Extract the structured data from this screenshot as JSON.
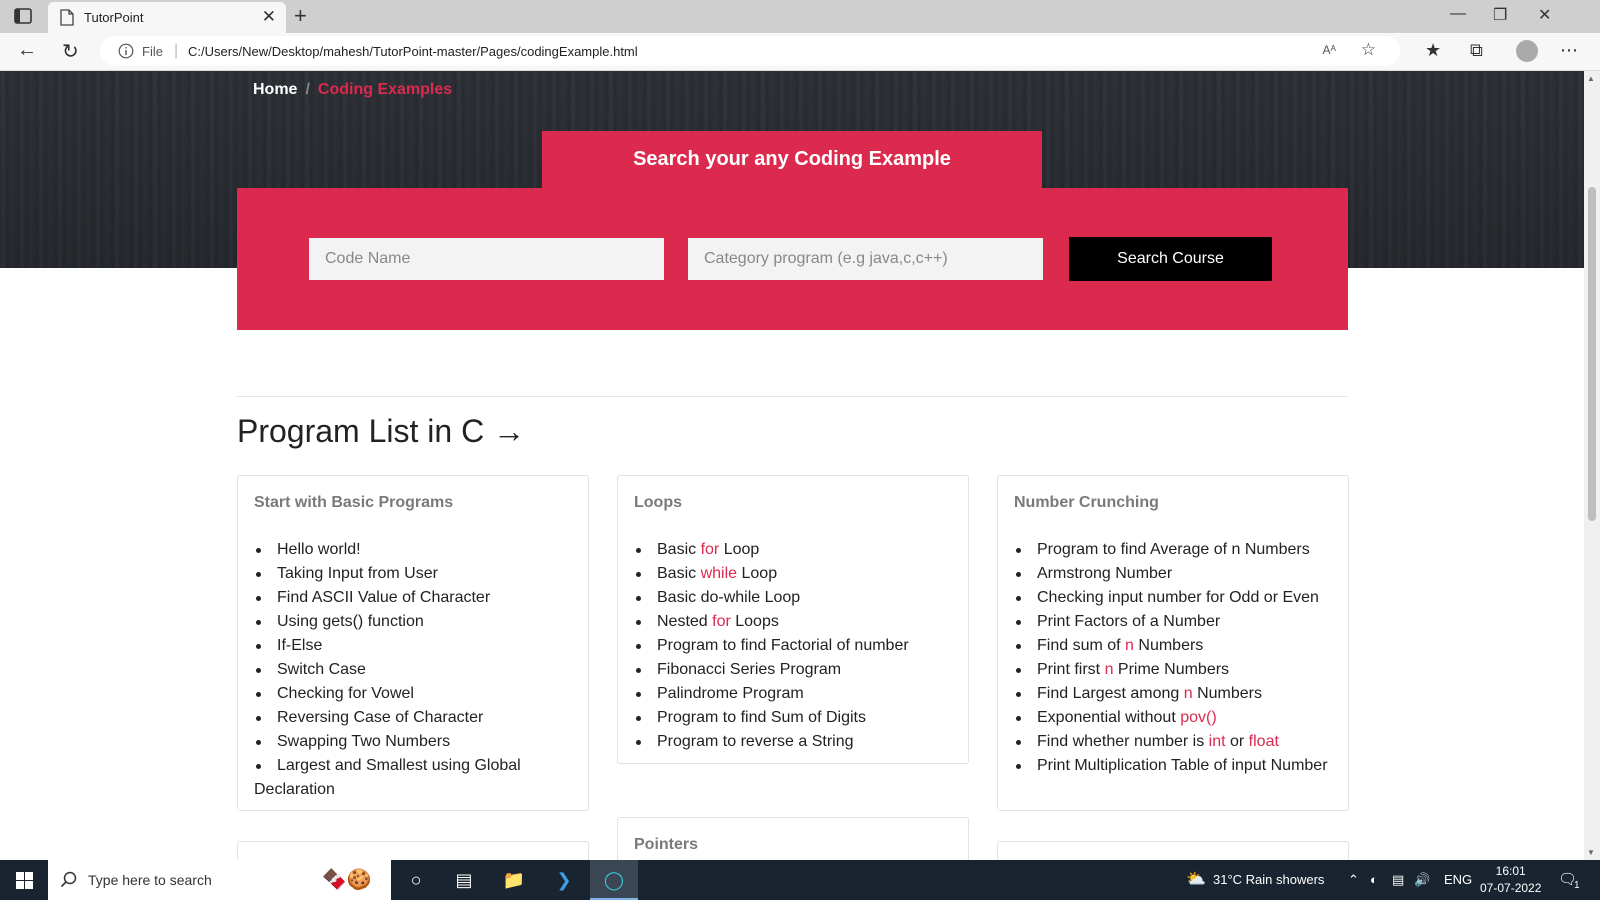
{
  "browser": {
    "tab_title": "TutorPoint",
    "new_tab_symbol": "+",
    "close_symbol": "✕",
    "address_prefix": "File",
    "url": "C:/Users/New/Desktop/mahesh/TutorPoint-master/Pages/codingExample.html",
    "read_aloud_label": "Aᴬ"
  },
  "breadcrumb": {
    "home": "Home",
    "separator": "/",
    "current": "Coding Examples"
  },
  "search": {
    "title": "Search your any Coding Example",
    "code_placeholder": "Code Name",
    "category_placeholder": "Category program (e.g java,c,c++)",
    "button_label": "Search Course"
  },
  "section_title": "Program List in C →",
  "cards": {
    "basic": {
      "title": "Start with Basic Programs",
      "items": [
        "Hello world!",
        "Taking Input from User",
        "Find ASCII Value of Character",
        "Using gets() function",
        "If-Else",
        "Switch Case",
        "Checking for Vowel",
        "Reversing Case of Character",
        "Swapping Two Numbers",
        "Largest and Smallest using Global Declaration"
      ]
    },
    "loops": {
      "title": "Loops",
      "items": [
        {
          "pre": "Basic ",
          "kw": "for",
          "post": " Loop"
        },
        {
          "pre": "Basic ",
          "kw": "while",
          "post": " Loop"
        },
        {
          "pre": "Basic do-while Loop",
          "kw": "",
          "post": ""
        },
        {
          "pre": "Nested ",
          "kw": "for",
          "post": " Loops"
        },
        {
          "pre": "Program to find Factorial of number",
          "kw": "",
          "post": ""
        },
        {
          "pre": "Fibonacci Series Program",
          "kw": "",
          "post": ""
        },
        {
          "pre": "Palindrome Program",
          "kw": "",
          "post": ""
        },
        {
          "pre": "Program to find Sum of Digits",
          "kw": "",
          "post": ""
        },
        {
          "pre": "Program to reverse a String",
          "kw": "",
          "post": ""
        }
      ]
    },
    "numbers": {
      "title": "Number Crunching",
      "items": [
        {
          "pre": "Program to find Average of n Numbers",
          "kw": "",
          "post": "",
          "kw2": "",
          "post2": ""
        },
        {
          "pre": "Armstrong Number",
          "kw": "",
          "post": "",
          "kw2": "",
          "post2": ""
        },
        {
          "pre": "Checking input number for Odd or Even",
          "kw": "",
          "post": "",
          "kw2": "",
          "post2": ""
        },
        {
          "pre": "Print Factors of a Number",
          "kw": "",
          "post": "",
          "kw2": "",
          "post2": ""
        },
        {
          "pre": "Find sum of ",
          "kw": "n",
          "post": " Numbers",
          "kw2": "",
          "post2": ""
        },
        {
          "pre": "Print first ",
          "kw": "n",
          "post": " Prime Numbers",
          "kw2": "",
          "post2": ""
        },
        {
          "pre": "Find Largest among ",
          "kw": "n",
          "post": " Numbers",
          "kw2": "",
          "post2": ""
        },
        {
          "pre": "Exponential without ",
          "kw": "pov()",
          "post": "",
          "kw2": "",
          "post2": ""
        },
        {
          "pre": "Find whether number is ",
          "kw": "int",
          "post": " or ",
          "kw2": "float",
          "post2": ""
        },
        {
          "pre": "Print Multiplication Table of input Number",
          "kw": "",
          "post": "",
          "kw2": "",
          "post2": ""
        }
      ]
    },
    "pointers": {
      "title": "Pointers"
    }
  },
  "taskbar": {
    "search_placeholder": "Type here to search",
    "weather": "31°C  Rain showers",
    "language": "ENG",
    "time": "16:01",
    "date": "07-07-2022",
    "notification_count": "1"
  },
  "colors": {
    "accent": "#dc2a4f",
    "button_dark": "#000000",
    "taskbar": "#1a2431"
  }
}
